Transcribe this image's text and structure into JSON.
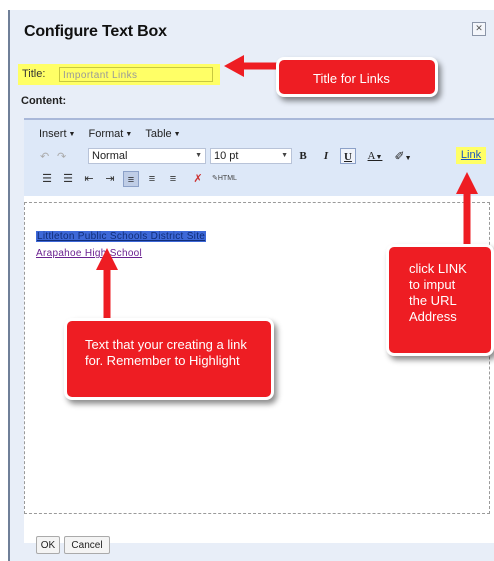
{
  "dialog": {
    "title": "Configure Text Box",
    "close_icon": "close-icon"
  },
  "fields": {
    "title_label": "Title:",
    "title_value": "Important Links",
    "content_label": "Content:"
  },
  "toolbar": {
    "menus": [
      "Insert",
      "Format",
      "Table"
    ],
    "style_select": "Normal",
    "size_select": "10 pt",
    "bold": "B",
    "italic": "I",
    "underline": "U",
    "link_label": "Link"
  },
  "content": {
    "link1": "Littleton Public Schools District Site",
    "link2": "Arapahoe High School"
  },
  "buttons": {
    "ok": "OK",
    "cancel": "Cancel"
  },
  "callouts": {
    "title": "Title for Links",
    "text": "Text that your creating a link for. Remember to Highlight",
    "link": "click LINK to imput the URL Address"
  },
  "colors": {
    "callout": "#ee1d23",
    "highlight": "#ffff66",
    "selection": "#3d68d8"
  }
}
